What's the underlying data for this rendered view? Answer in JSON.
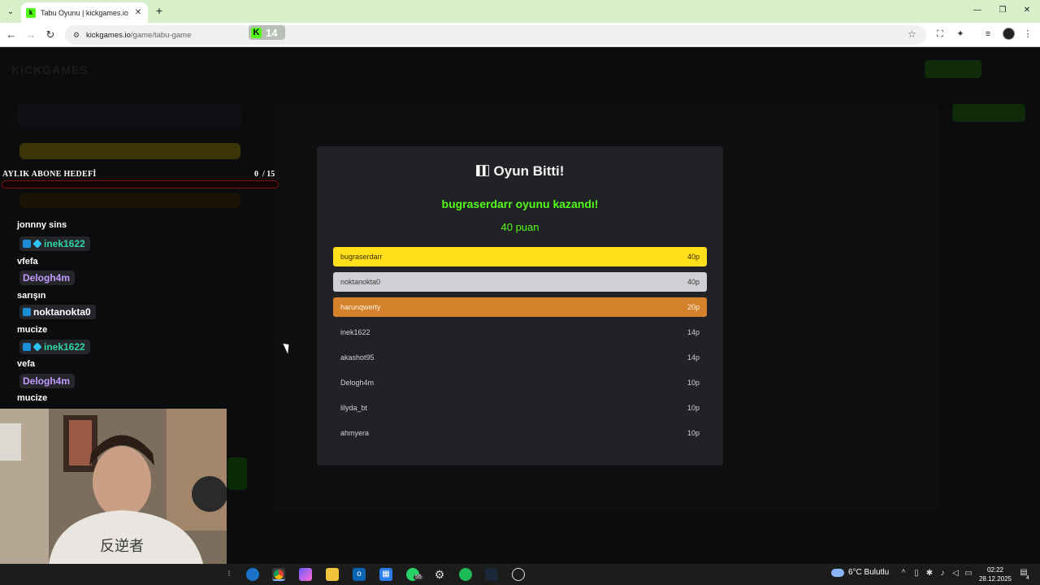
{
  "browser": {
    "tab_title": "Tabu Oyunu | kickgames.io",
    "url_host": "kickgames.io",
    "url_path": "/game/tabu-game",
    "kick_badge_count": "14"
  },
  "overlay": {
    "goal_title": "AYLIK ABONE HEDEFİ",
    "goal_current": "0",
    "goal_total": "/ 15",
    "goal_progress": 0
  },
  "chat": [
    {
      "type": "message",
      "text": "jonnny sins"
    },
    {
      "type": "user",
      "name": "inek1622",
      "color": "#2fd4a8"
    },
    {
      "type": "message",
      "text": "vfefa"
    },
    {
      "type": "user",
      "name": "Delogh4m",
      "color": "#c39bff"
    },
    {
      "type": "message",
      "text": "sarışın"
    },
    {
      "type": "user",
      "name": "noktanokta0",
      "color": "#ffffff"
    },
    {
      "type": "message",
      "text": "mucize"
    },
    {
      "type": "user",
      "name": "inek1622",
      "color": "#2fd4a8"
    },
    {
      "type": "message",
      "text": "vefa"
    },
    {
      "type": "user",
      "name": "Delogh4m",
      "color": "#c39bff"
    },
    {
      "type": "message",
      "text": "mucize"
    }
  ],
  "modal": {
    "title": "Oyun Bitti!",
    "winner_text": "bugraserdarr oyunu kazandı!",
    "winner_points": "40 puan",
    "scores": [
      {
        "name": "bugraserdarr",
        "points": "40p",
        "rank": "gold"
      },
      {
        "name": "noktanokta0",
        "points": "40p",
        "rank": "silver"
      },
      {
        "name": "harunqwerty",
        "points": "20p",
        "rank": "bronze"
      },
      {
        "name": "inek1622",
        "points": "14p",
        "rank": ""
      },
      {
        "name": "akashot95",
        "points": "14p",
        "rank": ""
      },
      {
        "name": "Delogh4m",
        "points": "10p",
        "rank": ""
      },
      {
        "name": "lilyda_bt",
        "points": "10p",
        "rank": ""
      },
      {
        "name": "ahmyera",
        "points": "10p",
        "rank": ""
      }
    ]
  },
  "taskbar": {
    "whatsapp_badge": "55",
    "weather": "6°C Bulutlu",
    "time": "02:22",
    "date": "28.12.2025",
    "notifications": "4"
  },
  "colors": {
    "accent": "#53fc18",
    "gold": "#ffe01b",
    "silver": "#cfd0d3",
    "bronze": "#d3812a"
  }
}
